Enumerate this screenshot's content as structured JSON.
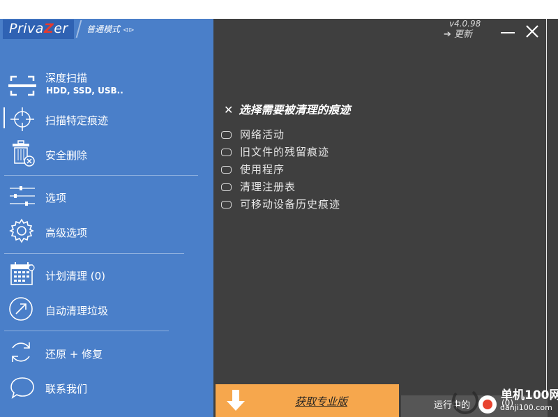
{
  "app": {
    "logo_prefix": "Priva",
    "logo_z": "Z",
    "logo_suffix": "er",
    "mode": "普通模式",
    "mode_arrows": "⊲⊳",
    "version": "v4.0.98",
    "update": "➔ 更新"
  },
  "sidebar": {
    "items": [
      {
        "label": "深度扫描",
        "sub": "HDD, SSD, USB..",
        "icon": "scan-icon"
      },
      {
        "label": "扫描特定痕迹",
        "icon": "crosshair-icon"
      },
      {
        "label": "安全删除",
        "icon": "trash-icon"
      },
      {
        "label": "选项",
        "icon": "sliders-icon"
      },
      {
        "label": "高级选项",
        "icon": "gear-icon"
      },
      {
        "label": "计划清理 (0)",
        "icon": "calendar-icon"
      },
      {
        "label": "自动清理垃圾",
        "icon": "auto-clean-icon"
      },
      {
        "label": "还原 + 修复",
        "icon": "restore-icon"
      },
      {
        "label": "联系我们",
        "icon": "chat-icon"
      }
    ]
  },
  "main": {
    "close_mark": "✕",
    "heading": "选择需要被清理的痕迹",
    "options": [
      {
        "label": "网络活动",
        "checked": false
      },
      {
        "label": "旧文件的残留痕迹",
        "checked": false
      },
      {
        "label": "使用程序",
        "checked": false
      },
      {
        "label": "清理注册表",
        "checked": false
      },
      {
        "label": "可移动设备历史痕迹",
        "checked": false
      }
    ]
  },
  "footer": {
    "promo": "获取专业版",
    "running": "运行中的",
    "running_count": "(0)"
  },
  "watermark": {
    "line1": "单机100网",
    "line2": "danji100.com"
  },
  "colors": {
    "sidebar": "#4a7fc9",
    "main": "#3f3f3f",
    "promo": "#f6a74d",
    "logo_z": "#e53b2f"
  }
}
